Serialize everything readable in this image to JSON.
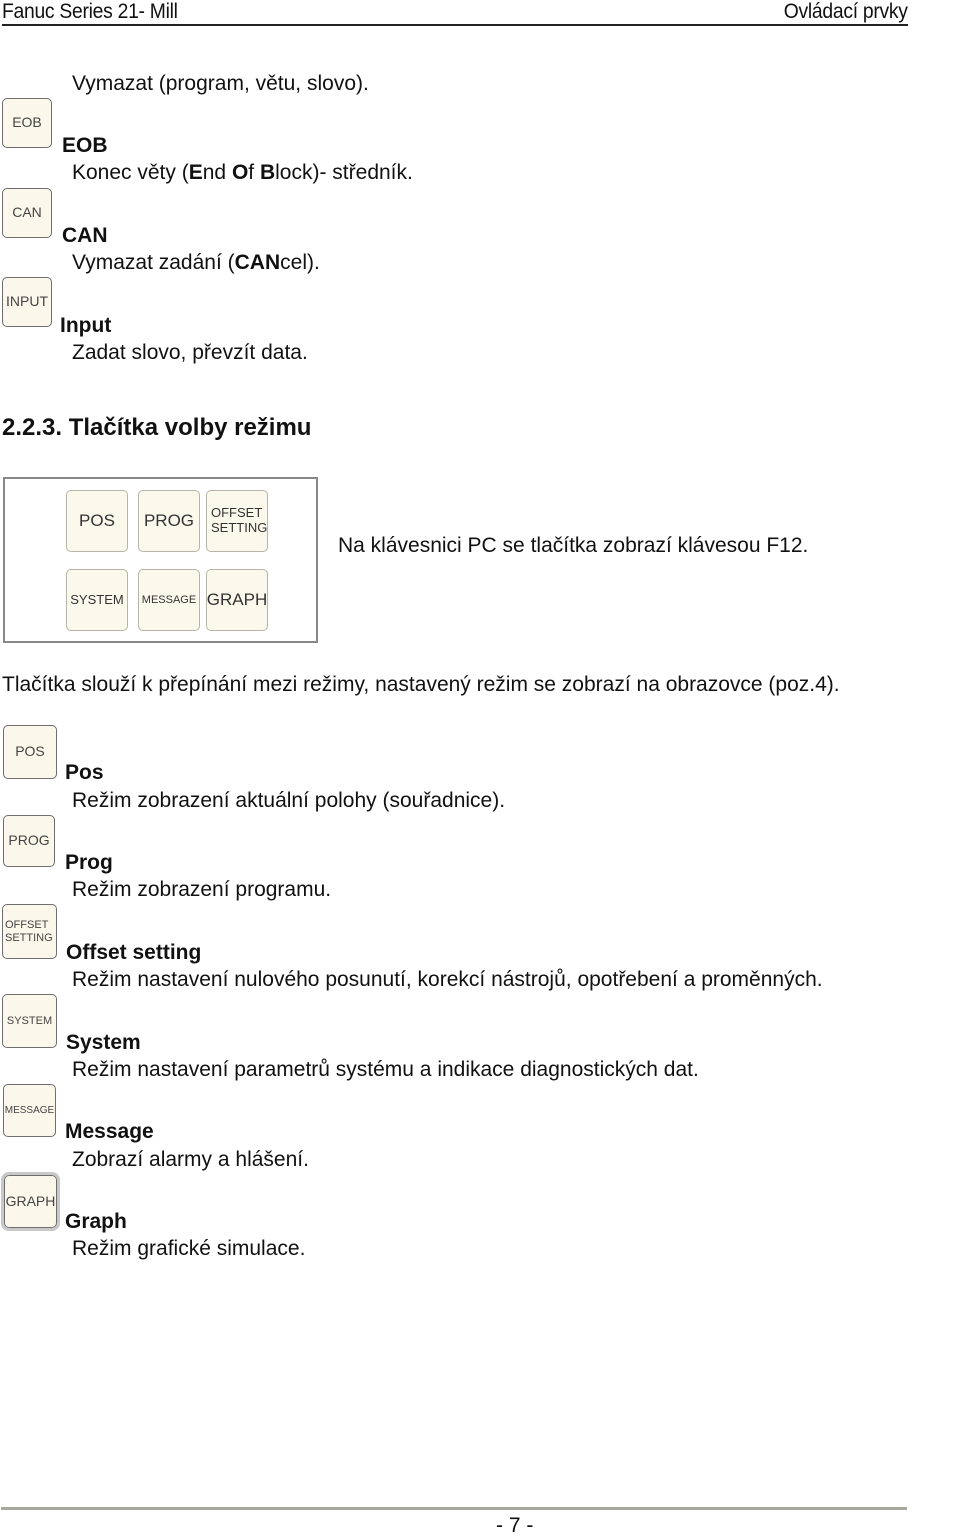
{
  "header": {
    "left": "Fanuc Series 21- Mill",
    "right": "Ovládací prvky"
  },
  "intro_line": "Vymazat (program, větu, slovo).",
  "edit_keys": [
    {
      "key": "EOB",
      "title": "EOB",
      "desc_parts": [
        "Konec věty (",
        "E",
        "nd ",
        "O",
        "f ",
        "B",
        "lock)- středník."
      ]
    },
    {
      "key": "CAN",
      "title": "CAN",
      "desc_parts": [
        "Vymazat zadání (",
        "CAN",
        "cel)."
      ]
    },
    {
      "key": "INPUT",
      "title": "Input",
      "desc": "Zadat slovo, převzít data."
    }
  ],
  "section": {
    "heading": "2.2.3. Tlačítka volby režimu",
    "panel_keys": [
      "POS",
      "PROG",
      "OFFSET SETTING",
      "SYSTEM",
      "MESSAGE",
      "GRAPH"
    ],
    "panel_note": "Na klávesnici PC se tlačítka zobrazí klávesou F12.",
    "paragraph": "Tlačítka slouží k přepínání mezi režimy, nastavený režim se zobrazí na obrazovce (poz.4)."
  },
  "mode_keys": [
    {
      "key": "POS",
      "title": "Pos",
      "desc": "Režim zobrazení aktuální polohy (souřadnice)."
    },
    {
      "key": "PROG",
      "title": "Prog",
      "desc": "Režim zobrazení programu."
    },
    {
      "key": "OFFSET SETTING",
      "title": "Offset setting",
      "desc": "Režim nastavení nulového posunutí, korekcí nástrojů, opotřebení a proměnných."
    },
    {
      "key": "SYSTEM",
      "title": "System",
      "desc": "Režim nastavení parametrů systému a indikace diagnostických dat."
    },
    {
      "key": "MESSAGE",
      "title": "Message",
      "desc": "Zobrazí alarmy a hlášení."
    },
    {
      "key": "GRAPH",
      "title": "Graph",
      "desc": "Režim grafické simulace."
    }
  ],
  "footer": {
    "page_number": "- 7 -"
  }
}
